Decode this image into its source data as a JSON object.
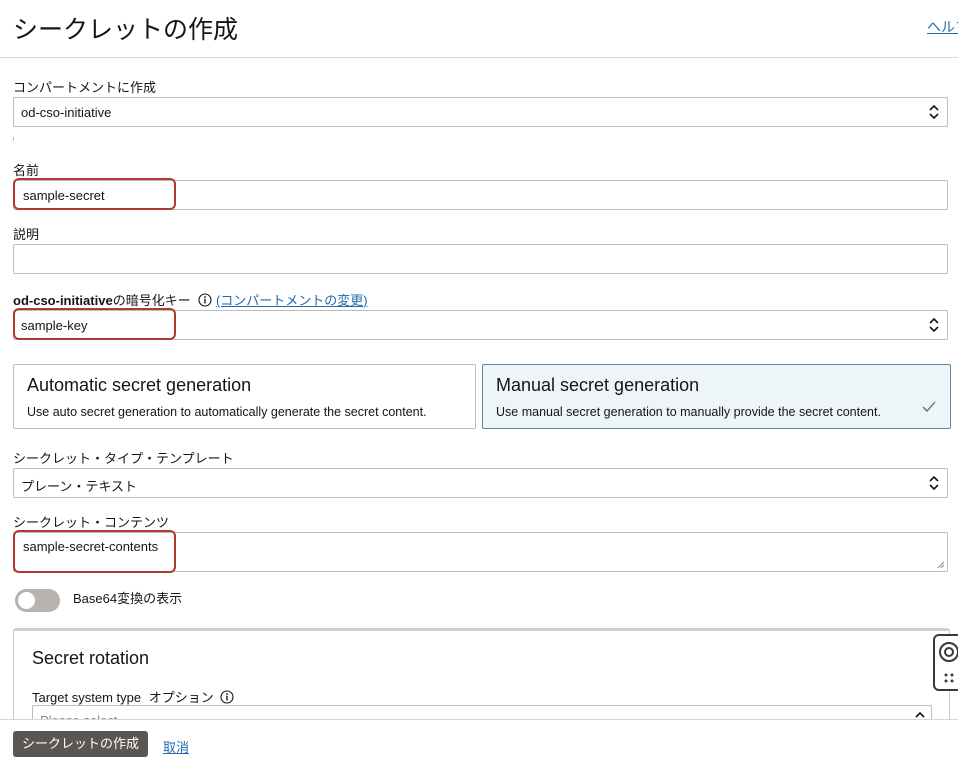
{
  "header": {
    "title": "シークレットの作成",
    "help_link": "ヘルプ"
  },
  "form": {
    "compartment": {
      "label": "コンパートメントに作成",
      "value": "od-cso-initiative"
    },
    "name": {
      "label": "名前",
      "value": "sample-secret"
    },
    "description": {
      "label": "説明",
      "value": ""
    },
    "encryption_key": {
      "label_bold": "od-cso-initiative",
      "label_rest": "の暗号化キー",
      "change_link": "(コンパートメントの変更)",
      "value": "sample-key"
    },
    "generation_options": [
      {
        "title": "Automatic secret generation",
        "description": "Use auto secret generation to automatically generate the secret content.",
        "selected": false
      },
      {
        "title": "Manual secret generation",
        "description": "Use manual secret generation to manually provide the secret content.",
        "selected": true
      }
    ],
    "secret_type_template": {
      "label": "シークレット・タイプ・テンプレート",
      "value": "プレーン・テキスト"
    },
    "secret_contents": {
      "label": "シークレット・コンテンツ",
      "value": "sample-secret-contents"
    },
    "base64_toggle": {
      "label": "Base64変換の表示",
      "on": false
    }
  },
  "rotation": {
    "title": "Secret rotation",
    "target_label": "Target system type",
    "target_optional": "オプション",
    "target_placeholder": "Please select"
  },
  "footer": {
    "create_button": "シークレットの作成",
    "cancel_link": "取消"
  },
  "colors": {
    "highlight": "#b03a2e",
    "link": "#1f6bae",
    "selected_card_bg": "#eef5f8",
    "primary_button": "#5b5652"
  }
}
